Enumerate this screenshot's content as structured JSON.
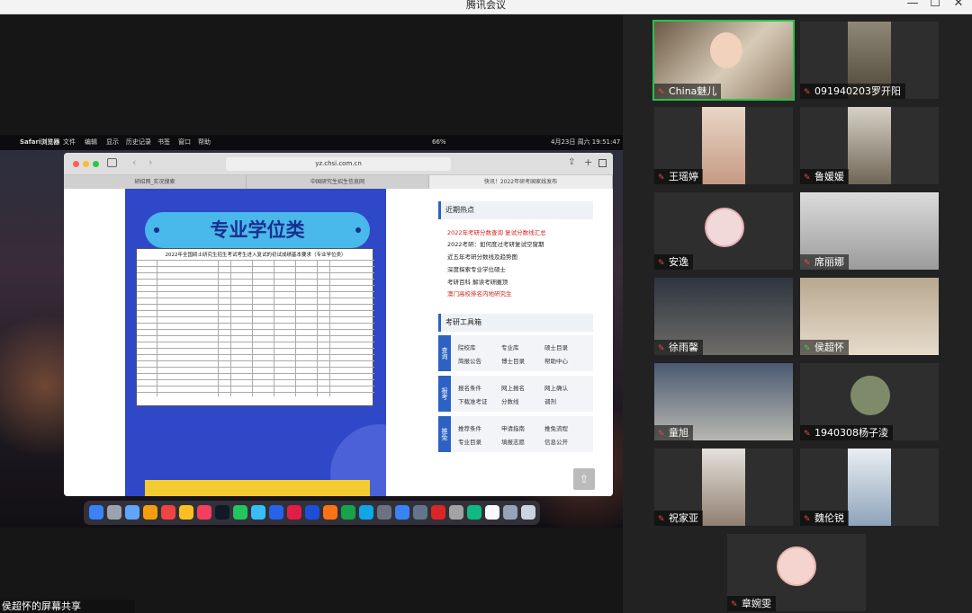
{
  "window": {
    "title": "腾讯会议",
    "minimize_glyph": "—",
    "maximize_glyph": "☐",
    "close_glyph": "✕"
  },
  "mac_menubar": {
    "apple_glyph": "",
    "app_name": "Safari浏览器",
    "menus": [
      "文件",
      "编辑",
      "显示",
      "历史记录",
      "书签",
      "窗口",
      "帮助"
    ],
    "battery": "66%",
    "datetime": "4月23日 周六 19:51:47"
  },
  "browser": {
    "url": "yz.chsi.com.cn",
    "tabs": [
      "研招网_实况搜索",
      "中国研究生招生信息网",
      "快讯！2022年研考国家线发布"
    ]
  },
  "poster": {
    "heading": "专业学位类",
    "table_title": "2022年全国硕士研究生招生考试考生进入复试的初试成绩基本要求（专业学位类）"
  },
  "sidebar": {
    "hot_title": "近期热点",
    "hot_items": [
      {
        "text": "2022年考研分数查询 复试分数线汇总",
        "color": "#d22222"
      },
      {
        "text": "2022考研：如何度过考研复试空窗期",
        "color": "#222222"
      },
      {
        "text": "近五年考研分数线及趋势图",
        "color": "#222222"
      },
      {
        "text": "深度探索专业学位硕士",
        "color": "#222222"
      },
      {
        "text": "考研百科 解读考研圈顶",
        "color": "#222222"
      },
      {
        "text": "澳门高校排名内地研究生",
        "color": "#d22222"
      }
    ],
    "tools_title": "考研工具箱",
    "boxes": [
      {
        "label": "查询",
        "links": [
          "院校库",
          "专业库",
          "硕士目录",
          "简报公告",
          "博士目录",
          "帮助中心"
        ]
      },
      {
        "label": "报考",
        "links": [
          "报名条件",
          "网上报名",
          "网上确认",
          "下载准考证",
          "分数线",
          "调剂"
        ]
      },
      {
        "label": "推免",
        "links": [
          "推荐条件",
          "申请指南",
          "推免流程",
          "专业目录",
          "填报志愿",
          "信息公开"
        ]
      }
    ],
    "scroll_top_glyph": "⇧"
  },
  "share_banner": "侯超怀的屏幕共享",
  "participants": [
    {
      "name": "China魅儿",
      "mic": "off"
    },
    {
      "name": "091940203罗开阳",
      "mic": "off"
    },
    {
      "name": "王瑶婷",
      "mic": "off"
    },
    {
      "name": "鲁媛媛",
      "mic": "off"
    },
    {
      "name": "安逸",
      "mic": "off"
    },
    {
      "name": "席丽娜",
      "mic": "off"
    },
    {
      "name": "徐雨馨",
      "mic": "off"
    },
    {
      "name": "侯超怀",
      "mic": "on"
    },
    {
      "name": "童旭",
      "mic": "off"
    },
    {
      "name": "1940308杨子淩",
      "mic": "off"
    },
    {
      "name": "祝家亚",
      "mic": "off"
    },
    {
      "name": "魏伦锐",
      "mic": "off"
    },
    {
      "name": "章婉雯",
      "mic": "off"
    }
  ]
}
